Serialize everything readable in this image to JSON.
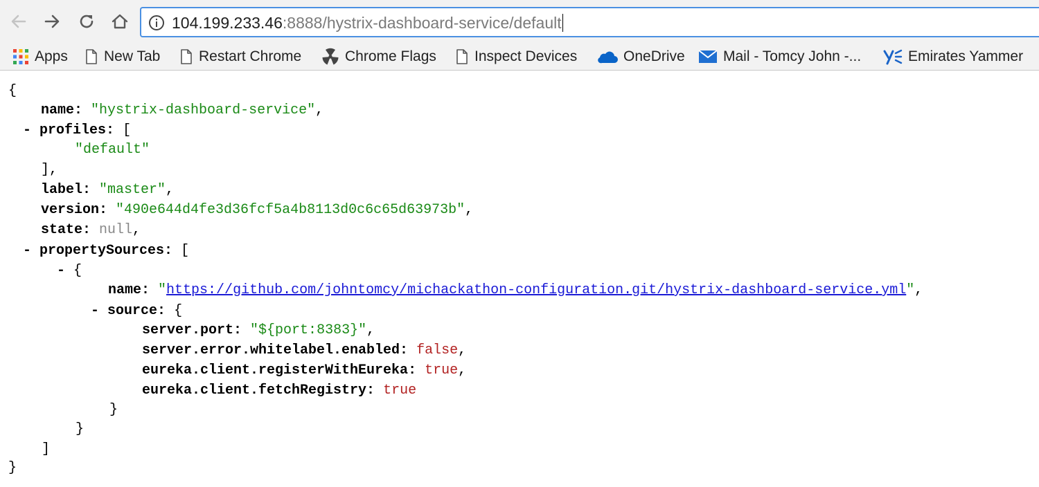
{
  "browser": {
    "url_host": "104.199.233.46",
    "url_path": ":8888/hystrix-dashboard-service/default",
    "bookmarks": [
      {
        "label": "Apps",
        "icon": "apps-grid-icon"
      },
      {
        "label": "New Tab",
        "icon": "page-icon"
      },
      {
        "label": "Restart Chrome",
        "icon": "page-icon"
      },
      {
        "label": "Chrome Flags",
        "icon": "radiation-icon"
      },
      {
        "label": "Inspect Devices",
        "icon": "page-icon"
      },
      {
        "label": "OneDrive",
        "icon": "cloud-icon"
      },
      {
        "label": "Mail - Tomcy John -...",
        "icon": "mail-icon"
      },
      {
        "label": "Emirates Yammer",
        "icon": "yammer-icon"
      }
    ]
  },
  "json": {
    "open_brace": "{",
    "close_brace": "}",
    "toggle": "-",
    "name_key": "name:",
    "name_value": "\"hystrix-dashboard-service\"",
    "profiles_key": "profiles:",
    "profiles_open": "[",
    "profiles_item": "\"default\"",
    "profiles_close": "],",
    "label_key": "label:",
    "label_value": "\"master\"",
    "version_key": "version:",
    "version_value": "\"490e644d4fe3d36fcf5a4b8113d0c6c65d63973b\"",
    "state_key": "state:",
    "state_value": "null",
    "property_sources_key": "propertySources:",
    "property_sources_open": "[",
    "item_open": "{",
    "source_name_key": "name:",
    "source_name_value": "https://github.com/johntomcy/michackathon-configuration.git/hystrix-dashboard-service.yml",
    "source_key": "source:",
    "source_open": "{",
    "server_port_key": "server.port:",
    "server_port_value": "\"${port:8383}\"",
    "whitelabel_key": "server.error.whitelabel.enabled:",
    "whitelabel_value": "false",
    "register_key": "eureka.client.registerWithEureka:",
    "register_value": "true",
    "fetch_key": "eureka.client.fetchRegistry:",
    "fetch_value": "true",
    "source_close": "}",
    "item_close": "}",
    "property_sources_close": "]"
  },
  "colors": {
    "string": "#1a8a16",
    "null": "#888888",
    "boolean": "#b22222",
    "link": "#1a1ad6",
    "omnibox_focus": "#4a90e2"
  }
}
